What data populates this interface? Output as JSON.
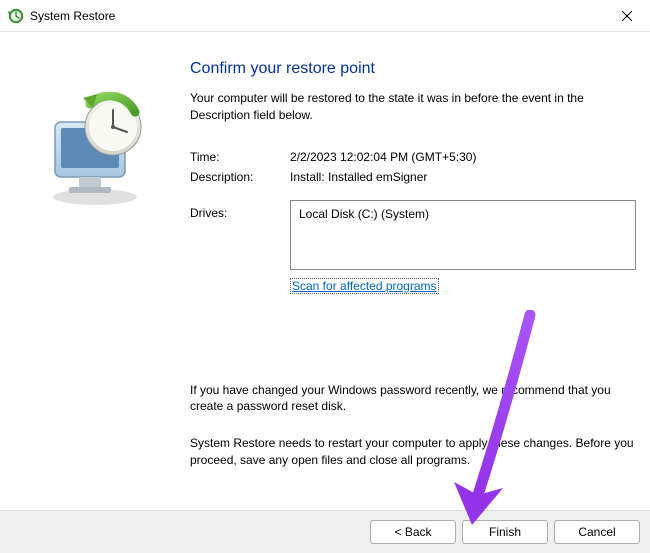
{
  "titlebar": {
    "title": "System Restore"
  },
  "heading": "Confirm your restore point",
  "subtext": "Your computer will be restored to the state it was in before the event in the Description field below.",
  "info": {
    "time_label": "Time:",
    "time_value": "2/2/2023 12:02:04 PM (GMT+5:30)",
    "desc_label": "Description:",
    "desc_value": "Install: Installed emSigner",
    "drives_label": "Drives:"
  },
  "drives": {
    "items": [
      "Local Disk (C:) (System)"
    ]
  },
  "scan_link": "Scan for affected programs",
  "note1": "If you have changed your Windows password recently, we recommend that you create a password reset disk.",
  "note2": "System Restore needs to restart your computer to apply these changes. Before you proceed, save any open files and close all programs.",
  "footer": {
    "back": "< Back",
    "finish": "Finish",
    "cancel": "Cancel"
  }
}
